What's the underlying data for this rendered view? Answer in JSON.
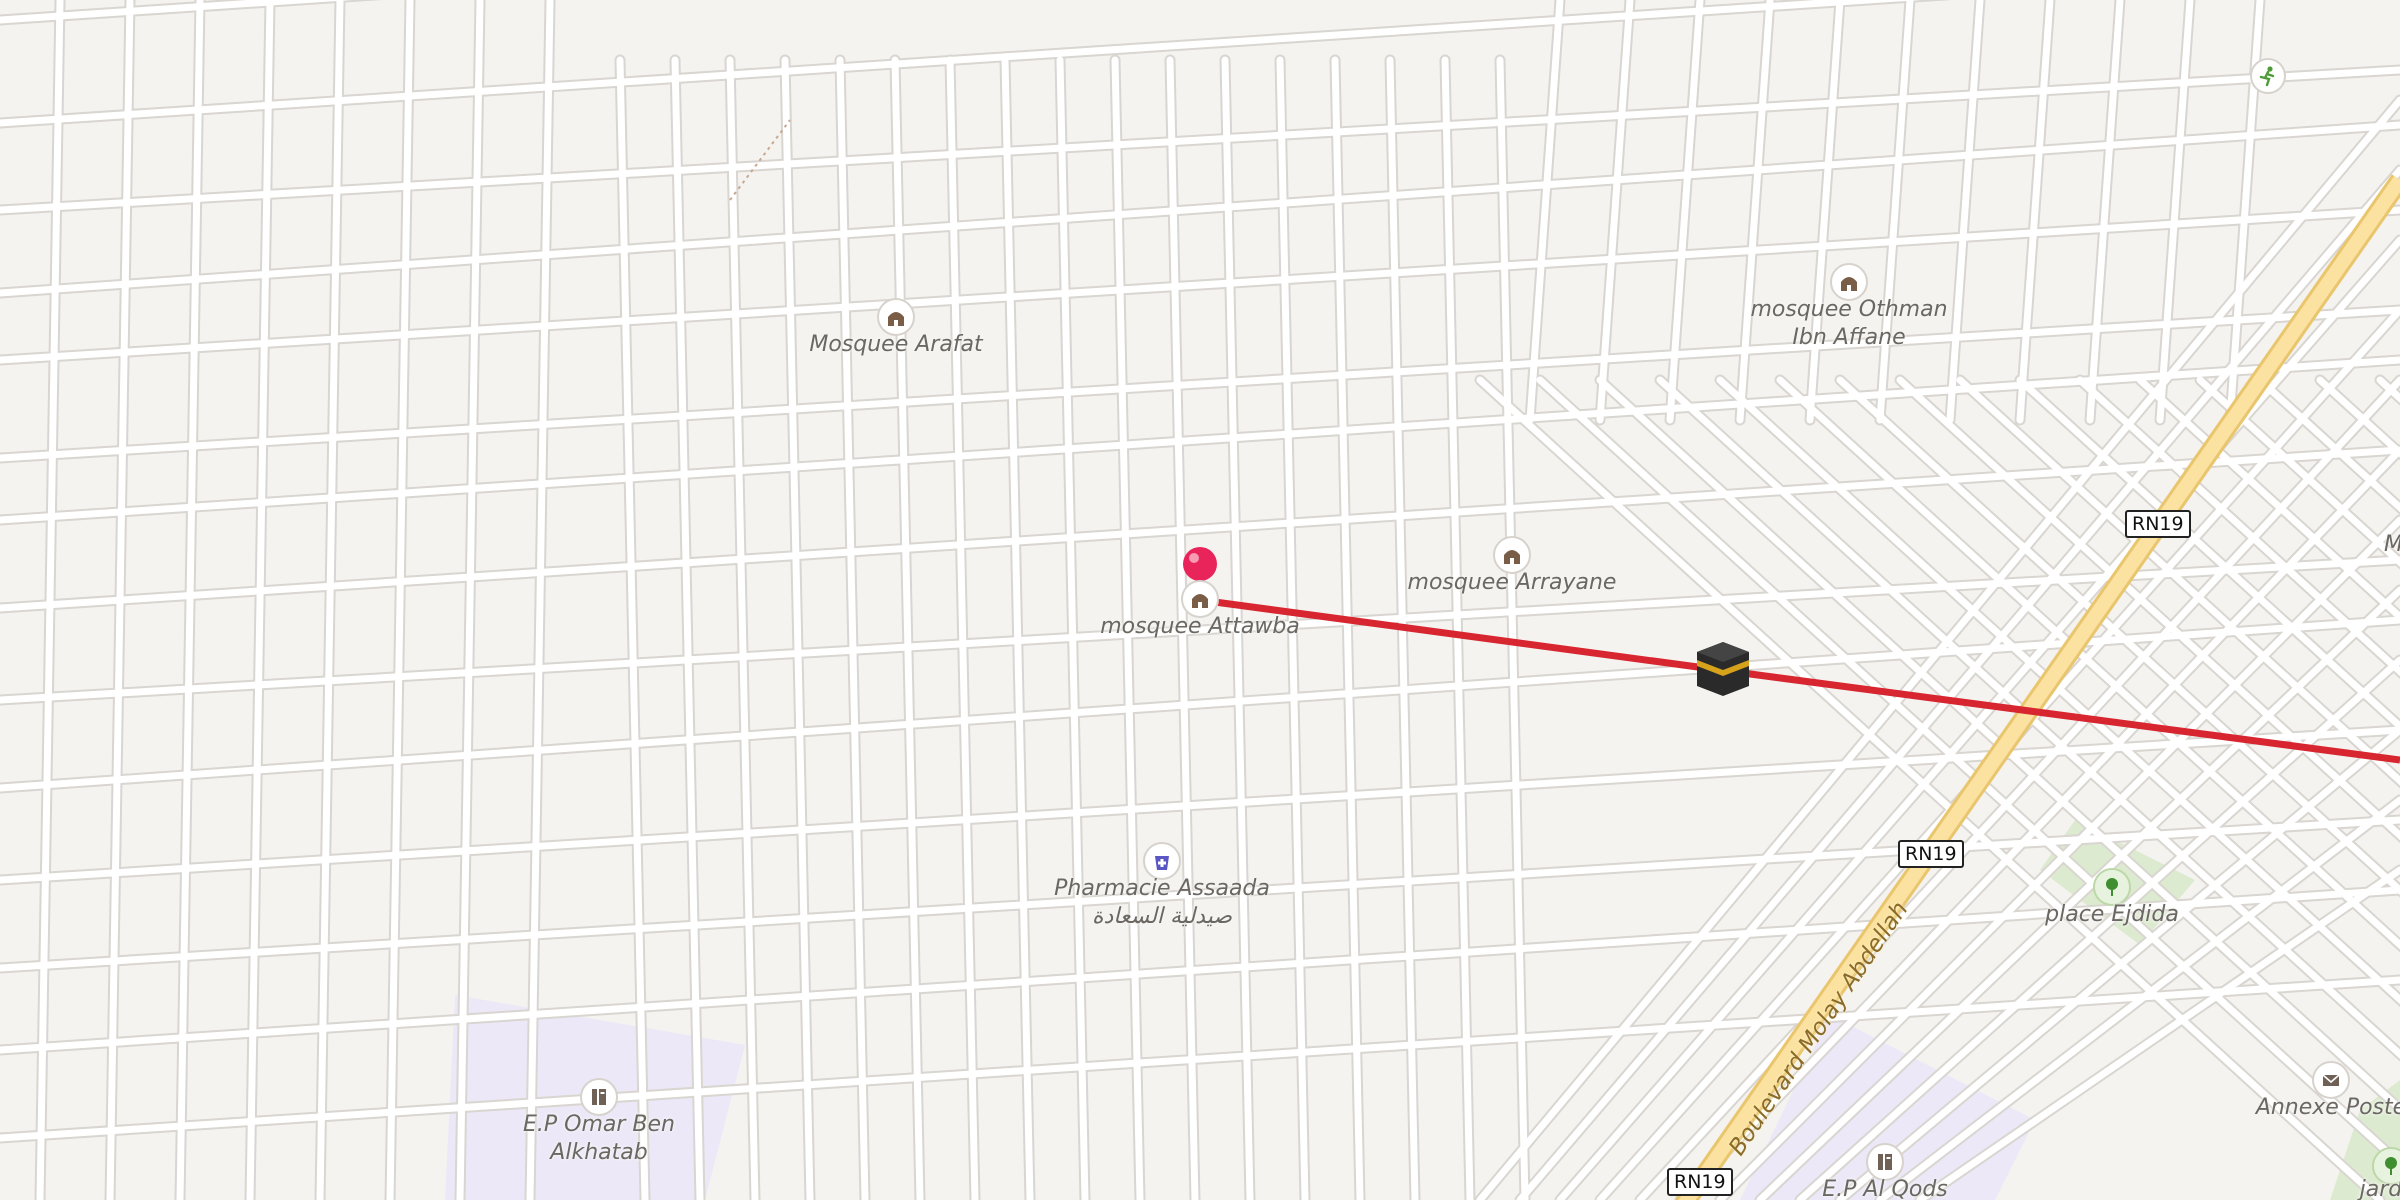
{
  "map": {
    "pois": [
      {
        "id": "mosquee-arafat",
        "label": "Mosquee Arafat",
        "icon": "mosque-icon"
      },
      {
        "id": "mosquee-othman",
        "label": "mosquee Othman",
        "label2": "Ibn Affane",
        "icon": "mosque-icon"
      },
      {
        "id": "mosquee-arrayane",
        "label": "mosquee Arrayane",
        "icon": "mosque-icon"
      },
      {
        "id": "mosquee-attawba",
        "label": "mosquee Attawba",
        "icon": "mosque-icon"
      },
      {
        "id": "pharmacie-assaada",
        "label": "Pharmacie Assaada",
        "label2": "صيدلية السعادة",
        "icon": "pharmacy-icon"
      },
      {
        "id": "ep-omar",
        "label": "E.P Omar Ben",
        "label2": "Alkhatab",
        "icon": "school-icon"
      },
      {
        "id": "ep-alqods",
        "label": "E.P Al Qods",
        "icon": "school-icon"
      },
      {
        "id": "place-ejdida",
        "label": "place Ejdida",
        "icon": "park-icon"
      },
      {
        "id": "annexe-poste",
        "label": "Annexe Poste",
        "icon": "post-icon"
      },
      {
        "id": "jardin",
        "label": "jardin",
        "icon": "park-icon"
      },
      {
        "id": "mo-partial",
        "label": "Mo",
        "icon": "mosque-icon"
      }
    ],
    "road_shields": [
      "RN19",
      "RN19",
      "RN19"
    ],
    "road_name": "Boulevard Molay Abdellah",
    "colors": {
      "background": "#f5f3f0",
      "street": "#ffffff",
      "street_casing": "#d9d5d0",
      "highway_fill": "#fbe2a0",
      "highway_casing": "#e9c66e",
      "route_line": "#d7262f",
      "pin": "#e8245a",
      "school_area": "#ece8f8",
      "park_area": "#dcebcf"
    },
    "icons": {
      "kaaba": "kaaba-icon",
      "pin": "location-pin-icon",
      "sport": "sport-icon"
    }
  }
}
